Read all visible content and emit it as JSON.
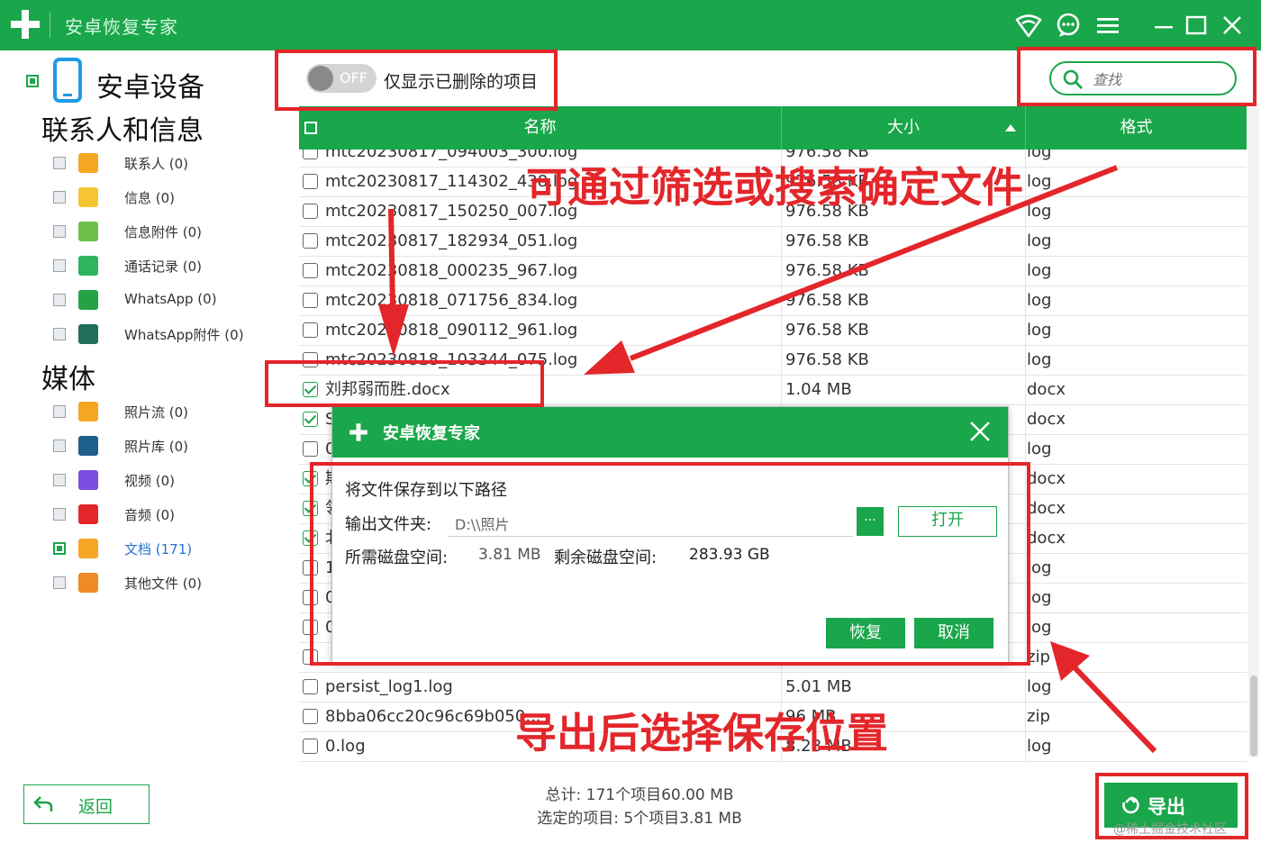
{
  "app": {
    "title": "安卓恢复专家"
  },
  "toggle": {
    "state": "OFF",
    "label": "仅显示已删除的项目"
  },
  "search": {
    "placeholder": "查找"
  },
  "sidebar": {
    "device": "安卓设备",
    "contacts_section": "联系人和信息",
    "contacts_items": [
      {
        "label": "联系人 (0)",
        "icon": "contact-icon",
        "color": "#f5a623"
      },
      {
        "label": "信息 (0)",
        "icon": "message-icon",
        "color": "#f6c532"
      },
      {
        "label": "信息附件 (0)",
        "icon": "attachment-icon",
        "color": "#6cc04a"
      },
      {
        "label": "通话记录 (0)",
        "icon": "phone-icon",
        "color": "#2db55d"
      },
      {
        "label": "WhatsApp (0)",
        "icon": "whatsapp-icon",
        "color": "#25a244"
      },
      {
        "label": "WhatsApp附件 (0)",
        "icon": "whatsapp-attachment-icon",
        "color": "#1f6f5a"
      }
    ],
    "media_section": "媒体",
    "media_items": [
      {
        "label": "照片流 (0)",
        "icon": "photostream-icon",
        "color": "#f5a623"
      },
      {
        "label": "照片库 (0)",
        "icon": "photo-library-icon",
        "color": "#1f5f8b"
      },
      {
        "label": "视频 (0)",
        "icon": "video-icon",
        "color": "#7b4fe0"
      },
      {
        "label": "音频 (0)",
        "icon": "audio-icon",
        "color": "#e3262a"
      },
      {
        "label": "文档 (171)",
        "icon": "document-icon",
        "color": "#f5a623"
      },
      {
        "label": "其他文件 (0)",
        "icon": "other-file-icon",
        "color": "#f08a24"
      }
    ],
    "back_label": "返回"
  },
  "table": {
    "columns": [
      "名称",
      "大小",
      "格式"
    ],
    "rows": [
      {
        "name": "mtc20230817_094003_300.log",
        "size": "976.58 KB",
        "format": "log",
        "checked": false
      },
      {
        "name": "mtc20230817_114302_438.log",
        "size": "976.58 KB",
        "format": "log",
        "checked": false
      },
      {
        "name": "mtc20230817_150250_007.log",
        "size": "976.58 KB",
        "format": "log",
        "checked": false
      },
      {
        "name": "mtc20230817_182934_051.log",
        "size": "976.58 KB",
        "format": "log",
        "checked": false
      },
      {
        "name": "mtc20230818_000235_967.log",
        "size": "976.58 KB",
        "format": "log",
        "checked": false
      },
      {
        "name": "mtc20230818_071756_834.log",
        "size": "976.58 KB",
        "format": "log",
        "checked": false
      },
      {
        "name": "mtc20230818_090112_961.log",
        "size": "976.58 KB",
        "format": "log",
        "checked": false
      },
      {
        "name": "mtc20230818_103344_075.log",
        "size": "976.58 KB",
        "format": "log",
        "checked": false
      },
      {
        "name": "刘邦弱而胜.docx",
        "size": "1.04 MB",
        "format": "docx",
        "checked": true
      },
      {
        "name": "S",
        "size": "",
        "format": "docx",
        "checked": true
      },
      {
        "name": "0",
        "size": "",
        "format": "log",
        "checked": false
      },
      {
        "name": "期",
        "size": "",
        "format": "docx",
        "checked": true
      },
      {
        "name": "领",
        "size": "",
        "format": "docx",
        "checked": true
      },
      {
        "name": "北",
        "size": "",
        "format": "docx",
        "checked": true
      },
      {
        "name": "1",
        "size": "",
        "format": "log",
        "checked": false
      },
      {
        "name": "0",
        "size": "",
        "format": "log",
        "checked": false
      },
      {
        "name": "0",
        "size": "",
        "format": "log",
        "checked": false
      },
      {
        "name": "",
        "size": "",
        "format": "zip",
        "checked": false
      },
      {
        "name": "persist_log1.log",
        "size": "5.01 MB",
        "format": "log",
        "checked": false
      },
      {
        "name": "8bba06cc20c96c69b050...",
        "size": "96 MB",
        "format": "zip",
        "checked": false
      },
      {
        "name": "0.log",
        "size": "8.28 MB",
        "format": "log",
        "checked": false
      }
    ]
  },
  "dialog": {
    "title": "安卓恢复专家",
    "heading": "将文件保存到以下路径",
    "output_label": "输出文件夹:",
    "output_value": "D:\\\\照片",
    "browse_label": "···",
    "open_label": "打开",
    "required_label": "所需磁盘空间:",
    "required_value": "3.81 MB",
    "remaining_label": "剩余磁盘空间:",
    "remaining_value": "283.93 GB",
    "recover_label": "恢复",
    "cancel_label": "取消"
  },
  "footer": {
    "total": "总计: 171个项目60.00 MB",
    "selected": "选定的项目: 5个项目3.81 MB",
    "export_label": "导出"
  },
  "annotations": {
    "top": "可通过筛选或搜索确定文件",
    "bottom": "导出后选择保存位置"
  },
  "watermark": "@稀土掘金技术社区",
  "colors": {
    "brand_green": "#1aa64a",
    "annotation_red": "#e3262a",
    "link_blue": "#2a72d4"
  }
}
